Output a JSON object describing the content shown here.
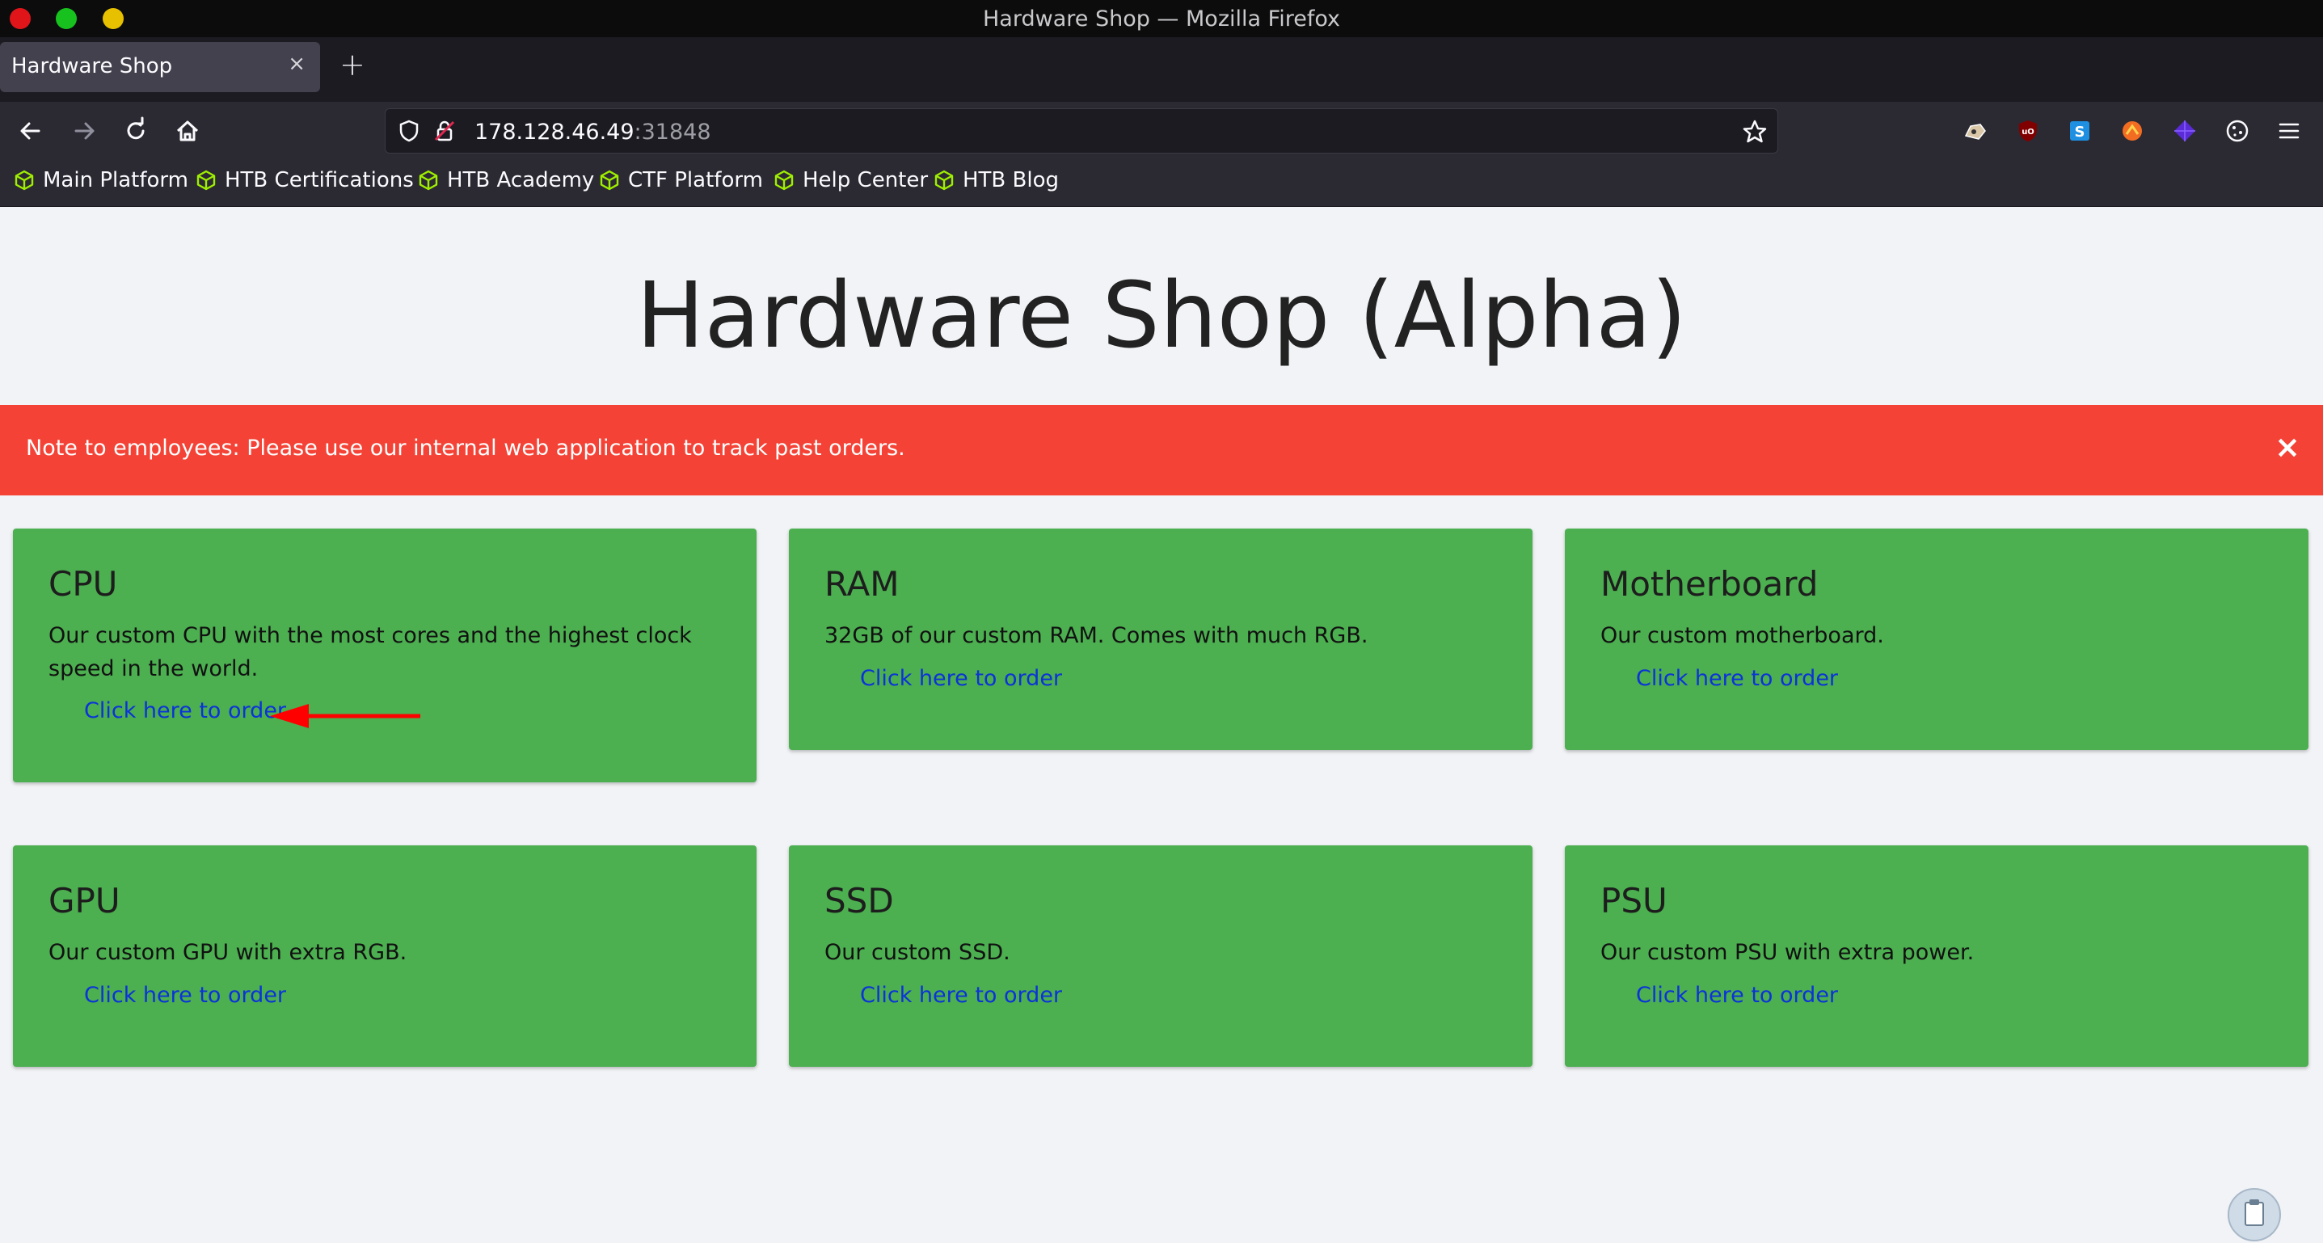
{
  "window": {
    "title": "Hardware Shop — Mozilla Firefox"
  },
  "tab": {
    "title": "Hardware Shop",
    "close": "×",
    "new_tab": "+"
  },
  "urlbar": {
    "host": "178.128.46.49",
    "port": ":31848"
  },
  "bookmarks": [
    {
      "label": "Main Platform"
    },
    {
      "label": "HTB Certifications"
    },
    {
      "label": "HTB Academy"
    },
    {
      "label": "CTF Platform"
    },
    {
      "label": "Help Center"
    },
    {
      "label": "HTB Blog"
    }
  ],
  "page": {
    "heading": "Hardware Shop (Alpha)",
    "alert": {
      "text": "Note to employees: Please use our internal web application to track past orders.",
      "close": "×"
    },
    "products": [
      {
        "title": "CPU",
        "description": "Our custom CPU with the most cores and the highest clock speed in the world.",
        "link": "Click here to order"
      },
      {
        "title": "RAM",
        "description": "32GB of our custom RAM. Comes with much RGB.",
        "link": "Click here to order"
      },
      {
        "title": "Motherboard",
        "description": "Our custom motherboard.",
        "link": "Click here to order"
      },
      {
        "title": "GPU",
        "description": "Our custom GPU with extra RGB.",
        "link": "Click here to order"
      },
      {
        "title": "SSD",
        "description": "Our custom SSD.",
        "link": "Click here to order"
      },
      {
        "title": "PSU",
        "description": "Our custom PSU with extra power.",
        "link": "Click here to order"
      }
    ]
  },
  "colors": {
    "alert": "#f44336",
    "card": "#4caf50",
    "link": "#0b33d8",
    "annotation_arrow": "#ff0000"
  }
}
